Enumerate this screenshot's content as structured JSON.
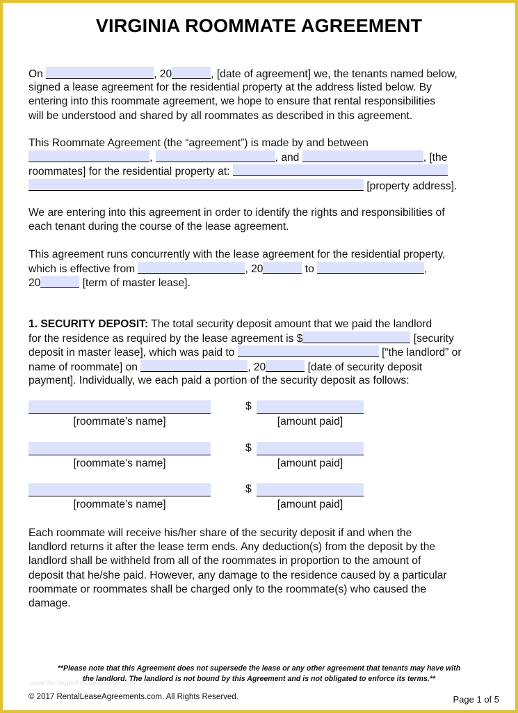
{
  "document": {
    "title": "VIRGINIA ROOMMATE AGREEMENT",
    "intro": {
      "line1": {
        "pre": "On ",
        "mid": ", 20",
        "post": ", [date of agreement] we, the tenants named below,"
      },
      "line2": "signed a lease agreement for the residential property at the address listed below. By",
      "line3": "entering into this roommate agreement, we hope to ensure that rental responsibilities",
      "line4": "will be understood and shared by all roommates as described in this agreement."
    },
    "parties": {
      "line1": "This Roommate Agreement (the “agreement”) is made by and between",
      "sep1": ", ",
      "and": ", and ",
      "the": ", [the",
      "line3_pre": "roommates] for the residential property at: ",
      "line4_post": " [property address]."
    },
    "purpose": {
      "line1": "We are entering into this agreement in order to identify the rights and responsibilities of",
      "line2": "each tenant during the course of the lease agreement."
    },
    "term": {
      "line1": "This agreement runs concurrently with the lease agreement for the residential property,",
      "line2_pre": "which is effective from ",
      "line2_mid": ", 20",
      "line2_to": " to ",
      "line2_post": ",",
      "line3_pre": "20",
      "line3_post": " [term of master lease]."
    },
    "security_deposit": {
      "heading": "1.  SECURITY DEPOSIT:",
      "line1_post": " The total security deposit amount that we paid the landlord",
      "line2_pre": "for the residence as required by the lease agreement is $",
      "line2_post": " [security",
      "line3_pre": "deposit in master lease], which was paid to ",
      "line3_post": " [“the landlord” or",
      "line4_pre": "name of roommate] on ",
      "line4_mid": ", 20",
      "line4_post": "   [date of security deposit",
      "line5": "payment]. Individually, we each paid a portion of the security deposit as follows:",
      "rows": [
        {
          "name_label": "[roommate’s name]",
          "currency": "$",
          "amount_label": "[amount paid]"
        },
        {
          "name_label": "[roommate’s name]",
          "currency": "$",
          "amount_label": "[amount paid]"
        },
        {
          "name_label": "[roommate’s name]",
          "currency": "$",
          "amount_label": "[amount paid]"
        }
      ],
      "closing": [
        "Each roommate will receive his/her share of the security deposit if and when the",
        "landlord returns it after the lease term ends. Any deduction(s) from the deposit by the",
        "landlord shall be withheld from all of the roommates in proportion to the amount of",
        "deposit that he/she paid. However, any damage to the residence caused by a particular",
        "roommate or roommates shall be charged only to the roommate(s) who caused the",
        "damage."
      ]
    },
    "footer": {
      "note_line1": "**Please note that this Agreement does not supersede the lease or any other agreement that tenants may have with",
      "note_line2": "the landlord. The landlord is not bound by this Agreement and is not obligated to enforce its terms.**",
      "watermark": "www.heritagechristiancollege.com",
      "copyright": "© 2017 RentalLeaseAgreements.com. All Rights Reserved.",
      "page": "Page 1 of 5"
    }
  }
}
